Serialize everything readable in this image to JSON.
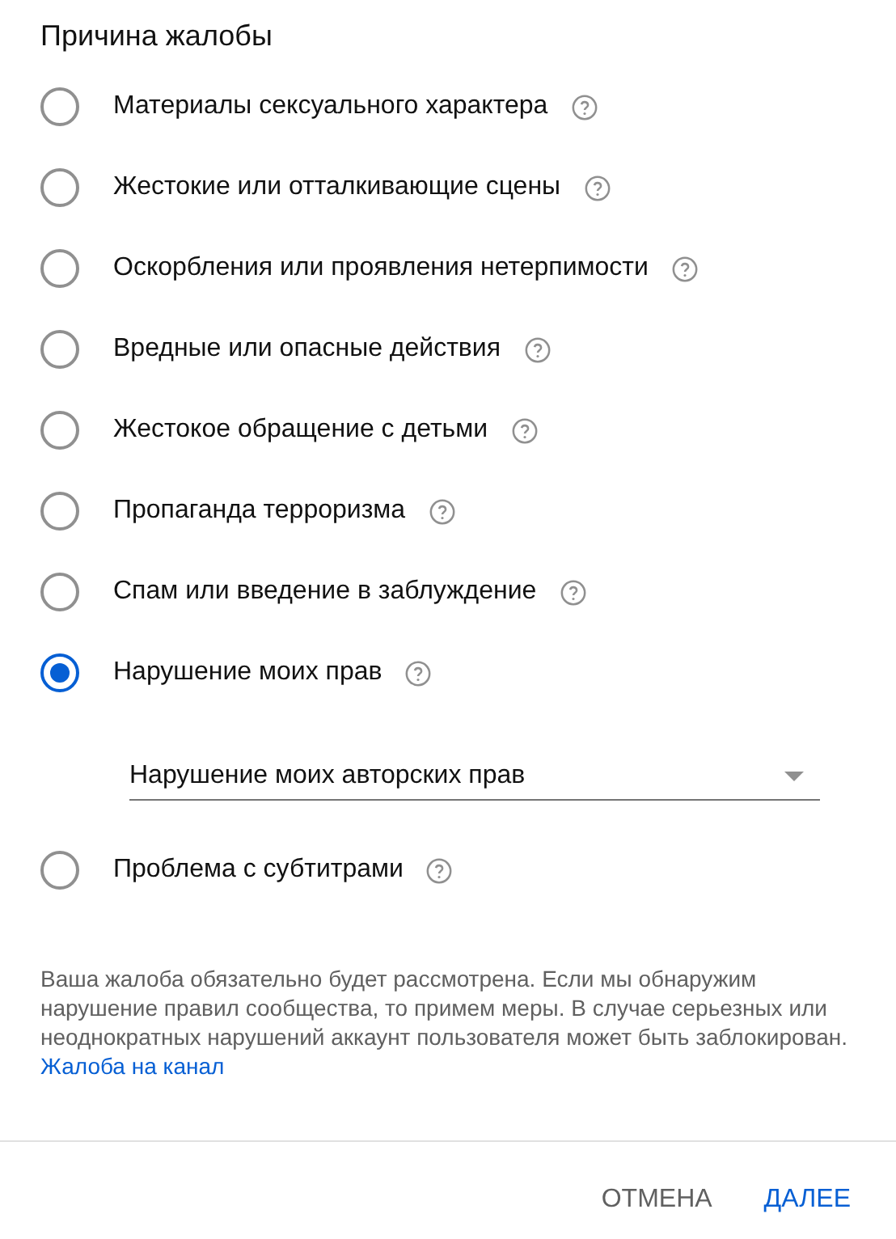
{
  "title": "Причина жалобы",
  "options": [
    {
      "label": "Материалы сексуального характера",
      "selected": false
    },
    {
      "label": "Жестокие или отталкивающие сцены",
      "selected": false
    },
    {
      "label": "Оскорбления или проявления нетерпимости",
      "selected": false
    },
    {
      "label": "Вредные или опасные действия",
      "selected": false
    },
    {
      "label": "Жестокое обращение с детьми",
      "selected": false
    },
    {
      "label": "Пропаганда терроризма",
      "selected": false
    },
    {
      "label": "Спам или введение в заблуждение",
      "selected": false
    },
    {
      "label": "Нарушение моих прав",
      "selected": true,
      "sub_select": {
        "value": "Нарушение моих авторских прав"
      }
    },
    {
      "label": "Проблема с субтитрами",
      "selected": false
    }
  ],
  "notice": {
    "text": "Ваша жалоба обязательно будет рассмотрена. Если мы обнаружим нарушение правил сообщества, то примем меры. В случае серьезных или неоднократных нарушений аккаунт пользователя может быть заблокирован.",
    "link": "Жалоба на канал"
  },
  "buttons": [
    {
      "label": "ОТМЕНА",
      "kind": "secondary"
    },
    {
      "label": "ДАЛЕЕ",
      "kind": "primary"
    }
  ]
}
